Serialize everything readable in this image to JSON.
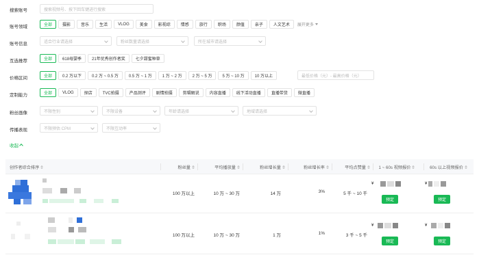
{
  "search": {
    "label": "搜索账号",
    "placeholder": "搜索视频号、按下回车键进行搜索"
  },
  "domain_filter": {
    "label": "账号领域",
    "options": [
      "全部",
      "摄影",
      "音乐",
      "生活",
      "VLOG",
      "美食",
      "影视综",
      "情感",
      "旅行",
      "职场",
      "颜值",
      "亲子",
      "人文艺术"
    ],
    "active": "全部",
    "more_label": "展开更多"
  },
  "account_info": {
    "label": "账号信息",
    "industry_placeholder": "适合行业请选择",
    "fans_placeholder": "粉丝数量请选择",
    "city_placeholder": "所在城市请选择"
  },
  "recommend": {
    "label": "互选推荐",
    "options": [
      "全部",
      "618母婴季",
      "21年优秀创作者奖",
      "七夕甜蜜种草"
    ],
    "active": "全部"
  },
  "price_range": {
    "label": "价格区间",
    "options": [
      "全部",
      "0.2 万以下",
      "0.2 万 ~ 0.5 万",
      "0.5 万 ~ 1 万",
      "1 万 ~ 2 万",
      "2 万 ~ 5 万",
      "5 万 ~ 10 万",
      "10 万以上"
    ],
    "active": "全部",
    "custom_placeholder": "最低价格（元）- 最高价格（元）"
  },
  "custom_ability": {
    "label": "定制能力",
    "options": [
      "全部",
      "VLOG",
      "探店",
      "TVC拍摄",
      "产品测评",
      "剧情拍摄",
      "剪辑解说",
      "内容直播",
      "线下活动直播",
      "直播带货",
      "微直播"
    ],
    "active": "全部"
  },
  "fans_profile": {
    "label": "粉丝画像",
    "gender_placeholder": "不限性别",
    "device_placeholder": "不限设备",
    "age_placeholder": "年龄请选择",
    "region_placeholder": "地域请选择"
  },
  "spread": {
    "label": "传播表现",
    "cpm_placeholder": "不限预估 CPM",
    "interaction_placeholder": "不限互动率"
  },
  "collapse_label": "收起",
  "table": {
    "headers": {
      "creator": "创作者综合排序",
      "fans": "粉丝量",
      "avg_play": "平均播放量",
      "fans_growth": "粉丝增长量",
      "fans_growth_rate": "粉丝增长率",
      "avg_likes": "平均点赞量",
      "price_short": "1 ~ 60s 视频报价",
      "price_long": "60s 以上视频报价"
    },
    "rows": [
      {
        "fans": "100 万以上",
        "avg_play": "10 万 ~ 30 万",
        "fans_growth": "14 万",
        "fans_growth_rate": "3%",
        "avg_likes": "5 千 ~ 10 千",
        "currency": "¥",
        "book_label": "预定"
      },
      {
        "fans": "100 万以上",
        "avg_play": "10 万 ~ 30 万",
        "fans_growth": "1 万",
        "fans_growth_rate": "1%",
        "avg_likes": "3 千 ~ 5 千",
        "currency": "¥",
        "book_label": "预定"
      }
    ]
  },
  "colors": {
    "accent": "#19b955",
    "avatar_blue": "#2f6fd8",
    "blur_gray": "#9a9a9a",
    "blur_green": "#c9efd7"
  }
}
